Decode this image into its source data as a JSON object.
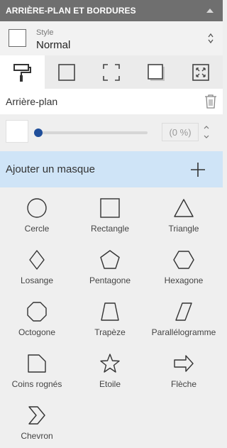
{
  "panel": {
    "title": "ARRIÈRE-PLAN ET BORDURES",
    "accent": "#1f4e9a",
    "mask_highlight": "#cfe4f7"
  },
  "style": {
    "label": "Style",
    "value": "Normal"
  },
  "tabs": [
    {
      "icon": "paint-roller-icon",
      "active": true
    },
    {
      "icon": "square-border-icon",
      "active": false
    },
    {
      "icon": "corners-border-icon",
      "active": false
    },
    {
      "icon": "shadow-square-icon",
      "active": false
    },
    {
      "icon": "fit-arrows-icon",
      "active": false
    }
  ],
  "background": {
    "label": "Arrière-plan",
    "opacity_percent": 0,
    "opacity_text": "(0 %)"
  },
  "mask": {
    "label": "Ajouter un masque"
  },
  "shapes": [
    {
      "name": "Cercle",
      "icon": "circle-icon"
    },
    {
      "name": "Rectangle",
      "icon": "rectangle-icon"
    },
    {
      "name": "Triangle",
      "icon": "triangle-icon"
    },
    {
      "name": "Losange",
      "icon": "diamond-icon"
    },
    {
      "name": "Pentagone",
      "icon": "pentagon-icon"
    },
    {
      "name": "Hexagone",
      "icon": "hexagon-icon"
    },
    {
      "name": "Octogone",
      "icon": "octagon-icon"
    },
    {
      "name": "Trapèze",
      "icon": "trapezoid-icon"
    },
    {
      "name": "Parallélogramme",
      "icon": "parallelogram-icon"
    },
    {
      "name": "Coins rognés",
      "icon": "snipped-corner-icon"
    },
    {
      "name": "Etoile",
      "icon": "star-icon"
    },
    {
      "name": "Flèche",
      "icon": "arrow-icon"
    },
    {
      "name": "Chevron",
      "icon": "chevron-icon"
    }
  ]
}
